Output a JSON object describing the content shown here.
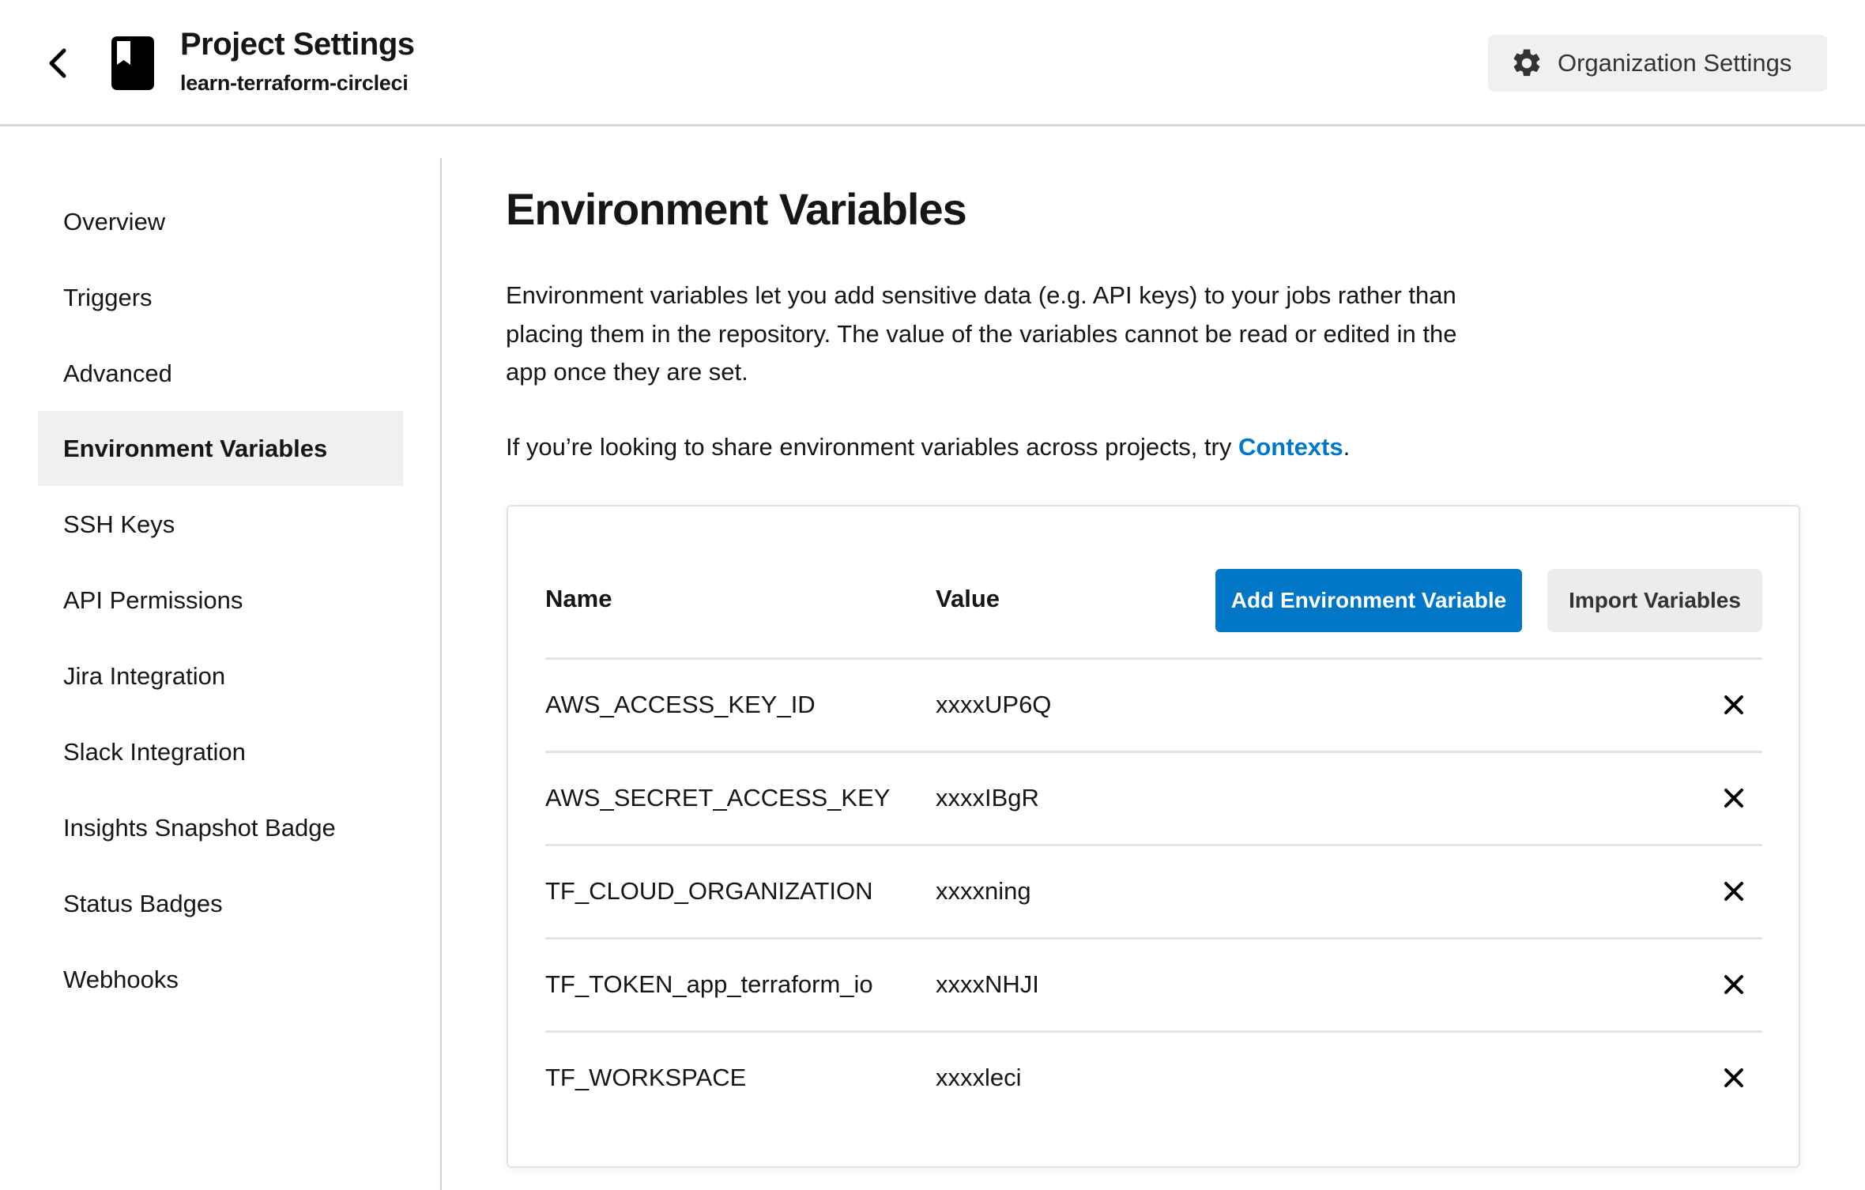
{
  "header": {
    "title": "Project Settings",
    "subtitle": "learn-terraform-circleci",
    "back_icon": "chevron-left-icon",
    "project_icon": "book-bookmark-icon",
    "org_settings_label": "Organization Settings",
    "org_settings_icon": "gear-icon"
  },
  "sidebar": {
    "items": [
      {
        "label": "Overview",
        "active": false
      },
      {
        "label": "Triggers",
        "active": false
      },
      {
        "label": "Advanced",
        "active": false
      },
      {
        "label": "Environment Variables",
        "active": true
      },
      {
        "label": "SSH Keys",
        "active": false
      },
      {
        "label": "API Permissions",
        "active": false
      },
      {
        "label": "Jira Integration",
        "active": false
      },
      {
        "label": "Slack Integration",
        "active": false
      },
      {
        "label": "Insights Snapshot Badge",
        "active": false
      },
      {
        "label": "Status Badges",
        "active": false
      },
      {
        "label": "Webhooks",
        "active": false
      }
    ]
  },
  "main": {
    "heading": "Environment Variables",
    "description": "Environment variables let you add sensitive data (e.g. API keys) to your jobs rather than placing them in the repository. The value of the variables cannot be read or edited in the app once they are set.",
    "share_text": "If you’re looking to share environment variables across projects, try ",
    "share_link": "Contexts",
    "share_suffix": ".",
    "table": {
      "columns": {
        "name": "Name",
        "value": "Value"
      },
      "add_button": "Add Environment Variable",
      "import_button": "Import Variables",
      "rows": [
        {
          "name": "AWS_ACCESS_KEY_ID",
          "value": "xxxxUP6Q"
        },
        {
          "name": "AWS_SECRET_ACCESS_KEY",
          "value": "xxxxIBgR"
        },
        {
          "name": "TF_CLOUD_ORGANIZATION",
          "value": "xxxxning"
        },
        {
          "name": "TF_TOKEN_app_terraform_io",
          "value": "xxxxNHJI"
        },
        {
          "name": "TF_WORKSPACE",
          "value": "xxxxleci"
        }
      ],
      "delete_icon": "close-icon"
    }
  },
  "colors": {
    "primary": "#0277c8",
    "link": "#0078ca",
    "active_nav_bg": "#f0f0f0",
    "secondary_button_bg": "#ececec",
    "text": "#161616"
  }
}
